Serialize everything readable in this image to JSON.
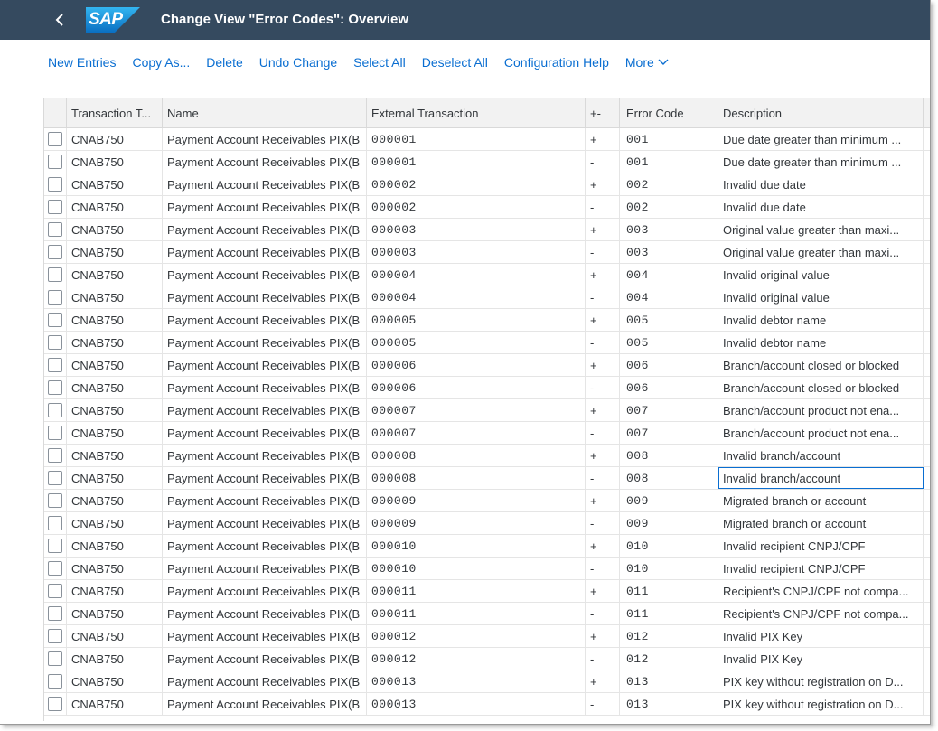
{
  "shell": {
    "title": "Change View \"Error Codes\": Overview",
    "logo_text": "SAP"
  },
  "toolbar": {
    "new_entries": "New Entries",
    "copy_as": "Copy As...",
    "delete": "Delete",
    "undo_change": "Undo Change",
    "select_all": "Select All",
    "deselect_all": "Deselect All",
    "configuration_help": "Configuration Help",
    "more": "More"
  },
  "table": {
    "headers": {
      "transaction_type": "Transaction T...",
      "name": "Name",
      "external_transaction": "External Transaction",
      "plus_minus": "+-",
      "error_code": "Error Code",
      "description": "Description"
    },
    "rows": [
      {
        "tt": "CNAB750",
        "name": "Payment Account Receivables PIX(B",
        "ext": "000001",
        "pm": "+",
        "err": "001",
        "desc": "Due date greater than minimum ..."
      },
      {
        "tt": "CNAB750",
        "name": "Payment Account Receivables PIX(B",
        "ext": "000001",
        "pm": "-",
        "err": "001",
        "desc": "Due date greater than minimum ..."
      },
      {
        "tt": "CNAB750",
        "name": "Payment Account Receivables PIX(B",
        "ext": "000002",
        "pm": "+",
        "err": "002",
        "desc": "Invalid due date"
      },
      {
        "tt": "CNAB750",
        "name": "Payment Account Receivables PIX(B",
        "ext": "000002",
        "pm": "-",
        "err": "002",
        "desc": "Invalid due date"
      },
      {
        "tt": "CNAB750",
        "name": "Payment Account Receivables PIX(B",
        "ext": "000003",
        "pm": "+",
        "err": "003",
        "desc": "Original value greater than maxi..."
      },
      {
        "tt": "CNAB750",
        "name": "Payment Account Receivables PIX(B",
        "ext": "000003",
        "pm": "-",
        "err": "003",
        "desc": "Original value greater than maxi..."
      },
      {
        "tt": "CNAB750",
        "name": "Payment Account Receivables PIX(B",
        "ext": "000004",
        "pm": "+",
        "err": "004",
        "desc": "Invalid original value"
      },
      {
        "tt": "CNAB750",
        "name": "Payment Account Receivables PIX(B",
        "ext": "000004",
        "pm": "-",
        "err": "004",
        "desc": "Invalid original value"
      },
      {
        "tt": "CNAB750",
        "name": "Payment Account Receivables PIX(B",
        "ext": "000005",
        "pm": "+",
        "err": "005",
        "desc": "Invalid debtor name"
      },
      {
        "tt": "CNAB750",
        "name": "Payment Account Receivables PIX(B",
        "ext": "000005",
        "pm": "-",
        "err": "005",
        "desc": "Invalid debtor name"
      },
      {
        "tt": "CNAB750",
        "name": "Payment Account Receivables PIX(B",
        "ext": "000006",
        "pm": "+",
        "err": "006",
        "desc": "Branch/account closed or blocked"
      },
      {
        "tt": "CNAB750",
        "name": "Payment Account Receivables PIX(B",
        "ext": "000006",
        "pm": "-",
        "err": "006",
        "desc": "Branch/account closed or blocked"
      },
      {
        "tt": "CNAB750",
        "name": "Payment Account Receivables PIX(B",
        "ext": "000007",
        "pm": "+",
        "err": "007",
        "desc": "Branch/account product not ena..."
      },
      {
        "tt": "CNAB750",
        "name": "Payment Account Receivables PIX(B",
        "ext": "000007",
        "pm": "-",
        "err": "007",
        "desc": "Branch/account product not ena..."
      },
      {
        "tt": "CNAB750",
        "name": "Payment Account Receivables PIX(B",
        "ext": "000008",
        "pm": "+",
        "err": "008",
        "desc": "Invalid branch/account"
      },
      {
        "tt": "CNAB750",
        "name": "Payment Account Receivables PIX(B",
        "ext": "000008",
        "pm": "-",
        "err": "008",
        "desc": "Invalid branch/account"
      },
      {
        "tt": "CNAB750",
        "name": "Payment Account Receivables PIX(B",
        "ext": "000009",
        "pm": "+",
        "err": "009",
        "desc": "Migrated branch or account"
      },
      {
        "tt": "CNAB750",
        "name": "Payment Account Receivables PIX(B",
        "ext": "000009",
        "pm": "-",
        "err": "009",
        "desc": "Migrated branch or account"
      },
      {
        "tt": "CNAB750",
        "name": "Payment Account Receivables PIX(B",
        "ext": "000010",
        "pm": "+",
        "err": "010",
        "desc": "Invalid recipient CNPJ/CPF"
      },
      {
        "tt": "CNAB750",
        "name": "Payment Account Receivables PIX(B",
        "ext": "000010",
        "pm": "-",
        "err": "010",
        "desc": "Invalid recipient CNPJ/CPF"
      },
      {
        "tt": "CNAB750",
        "name": "Payment Account Receivables PIX(B",
        "ext": "000011",
        "pm": "+",
        "err": "011",
        "desc": "Recipient's CNPJ/CPF not compa..."
      },
      {
        "tt": "CNAB750",
        "name": "Payment Account Receivables PIX(B",
        "ext": "000011",
        "pm": "-",
        "err": "011",
        "desc": "Recipient's CNPJ/CPF not compa..."
      },
      {
        "tt": "CNAB750",
        "name": "Payment Account Receivables PIX(B",
        "ext": "000012",
        "pm": "+",
        "err": "012",
        "desc": "Invalid PIX Key"
      },
      {
        "tt": "CNAB750",
        "name": "Payment Account Receivables PIX(B",
        "ext": "000012",
        "pm": "-",
        "err": "012",
        "desc": "Invalid PIX Key"
      },
      {
        "tt": "CNAB750",
        "name": "Payment Account Receivables PIX(B",
        "ext": "000013",
        "pm": "+",
        "err": "013",
        "desc": "PIX key without registration on D..."
      },
      {
        "tt": "CNAB750",
        "name": "Payment Account Receivables PIX(B",
        "ext": "000013",
        "pm": "-",
        "err": "013",
        "desc": "PIX key without registration on D..."
      }
    ]
  },
  "colors": {
    "shell_bg": "#354a5f",
    "link": "#0a6ed1",
    "logo_blue": "#1a8fd8"
  }
}
